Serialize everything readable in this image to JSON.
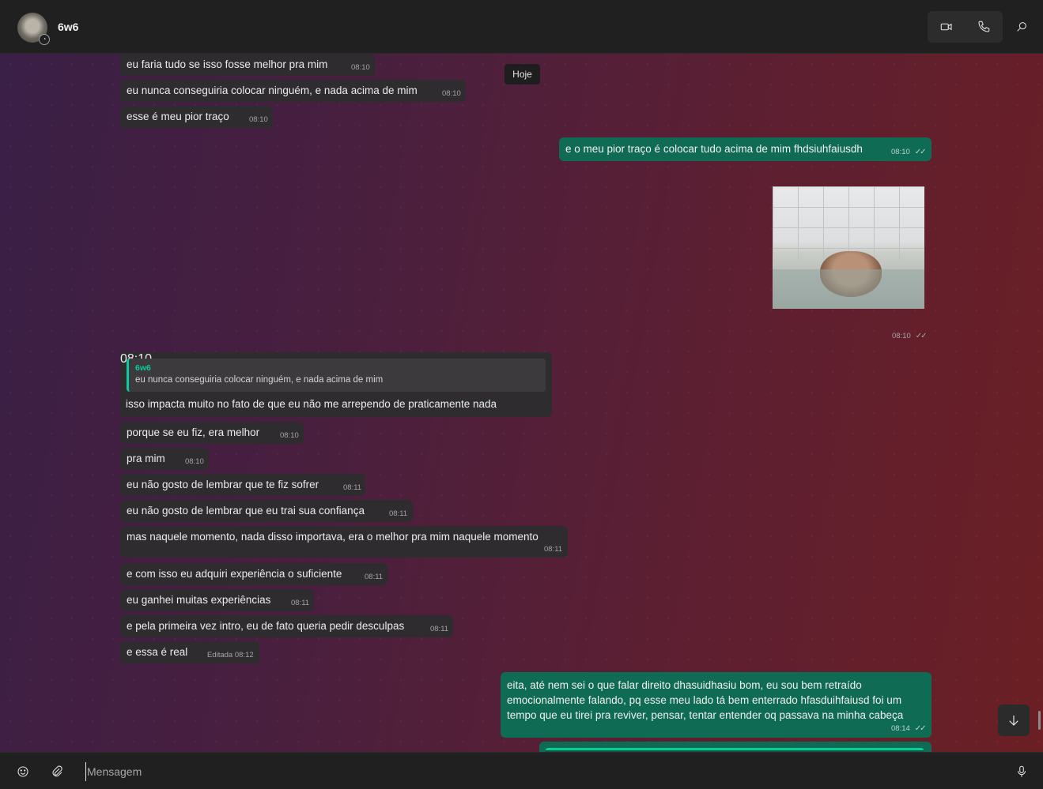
{
  "header": {
    "contact_name": "6w6",
    "avatar_badge_icon": "status-ring-icon",
    "video_icon": "video-call-icon",
    "voice_icon": "voice-call-icon",
    "search_icon": "search-icon"
  },
  "chat": {
    "date_label": "Hoje",
    "incoming_top": [
      {
        "text": "eu faria tudo se isso fosse melhor pra mim",
        "time": "08:10"
      },
      {
        "text": "eu nunca conseguiria colocar ninguém, e nada acima de mim",
        "time": "08:10"
      },
      {
        "text": "esse é meu pior traço",
        "time": "08:10"
      }
    ],
    "outgoing_1": {
      "text": "e o meu pior traço é colocar tudo acima de mim fhdsiuhfaiusdh",
      "time": "08:10"
    },
    "photo_time": "08:10",
    "reply": {
      "quoted_author": "6w6",
      "quoted_text": "eu nunca conseguiria colocar ninguém, e nada acima de mim",
      "text": "isso impacta muito no fato de que eu não me arrependo de praticamente nada",
      "time": "08:10"
    },
    "incoming_bottom": [
      {
        "text": "porque se eu fiz, era melhor",
        "time": "08:10"
      },
      {
        "text": "pra mim",
        "time": "08:10"
      },
      {
        "text": "eu não gosto de lembrar que te fiz sofrer",
        "time": "08:11"
      },
      {
        "text": "eu não gosto de lembrar que eu trai sua confiança",
        "time": "08:11"
      },
      {
        "text": "mas naquele momento, nada disso importava, era o melhor pra mim naquele momento",
        "time": "08:11"
      },
      {
        "text": "e com isso eu adquiri experiência o suficiente",
        "time": "08:11"
      },
      {
        "text": "eu ganhei muitas experiências",
        "time": "08:11"
      },
      {
        "text": "e pela primeira vez intro, eu de fato queria pedir desculpas",
        "time": "08:11"
      },
      {
        "text": "e essa é real",
        "time": "Editada 08:12"
      }
    ],
    "outgoing_2": {
      "lines": [
        "eita, até nem sei o que falar direito dhasuidhasiu bom, eu sou bem retraído",
        "emocionalmente falando, pq esse meu lado tá bem enterrado hfasduihfaiusd foi um",
        "tempo que eu tirei pra reviver, pensar, tentar entender oq passava na minha cabeça"
      ],
      "time": "08:14"
    },
    "read_ticks": "✓✓"
  },
  "composer": {
    "placeholder": "Mensagem"
  }
}
